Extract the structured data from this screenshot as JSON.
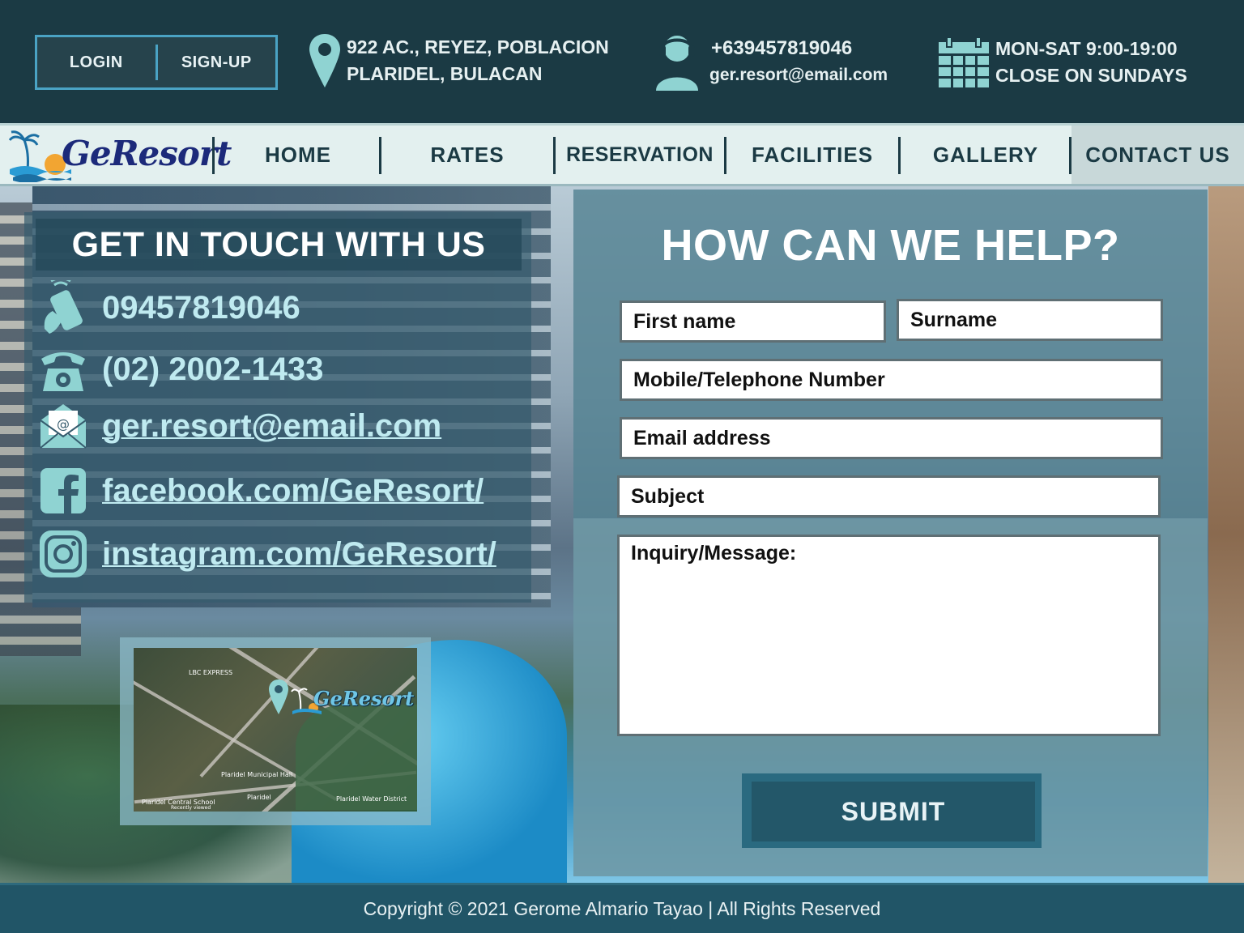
{
  "header": {
    "login_label": "LOGIN",
    "signup_label": "SIGN-UP",
    "address_line1": "922 AC., REYEZ, POBLACION",
    "address_line2": "PLARIDEL, BULACAN",
    "phone": "+639457819046",
    "email": "ger.resort@email.com",
    "hours_line1": "MON-SAT 9:00-19:00",
    "hours_line2": "CLOSE ON SUNDAYS",
    "icons": [
      "location-pin-icon",
      "customer-support-icon",
      "calendar-icon"
    ]
  },
  "nav": {
    "logo_text": "GeResort",
    "items": [
      {
        "label": "HOME"
      },
      {
        "label": "RATES"
      },
      {
        "label": "RESERVATION"
      },
      {
        "label": "FACILITIES"
      },
      {
        "label": "GALLERY"
      },
      {
        "label": "CONTACT US",
        "active": true
      }
    ]
  },
  "contact": {
    "title": "GET IN TOUCH WITH US",
    "mobile": "09457819046",
    "landline": "(02) 2002-1433",
    "email": "ger.resort@email.com",
    "facebook": "facebook.com/GeResort/",
    "instagram": "instagram.com/GeResort/",
    "icons": [
      "mobile-phone-icon",
      "telephone-icon",
      "email-icon",
      "facebook-icon",
      "instagram-icon"
    ]
  },
  "map": {
    "logo_text": "GeResort",
    "labels": [
      "LBC EXPRESS",
      "Plaridel Municipal Hall",
      "Plaridel Central School",
      "Plaridel Water District",
      "Plaridel",
      "Recently viewed"
    ]
  },
  "form": {
    "title": "HOW CAN WE HELP?",
    "first_name_placeholder": "First name",
    "surname_placeholder": "Surname",
    "phone_placeholder": "Mobile/Telephone Number",
    "email_placeholder": "Email address",
    "subject_placeholder": "Subject",
    "message_placeholder": "Inquiry/Message:",
    "submit_label": "SUBMIT"
  },
  "footer": {
    "copyright": "Copyright © 2021 Gerome Almario Tayao | All Rights Reserved"
  },
  "colors": {
    "topbar": "#1b3a44",
    "nav_bg": "#e3f0ef",
    "accent": "#4aa3c4",
    "contact_text": "#bfeaf0",
    "footer": "#215567"
  }
}
